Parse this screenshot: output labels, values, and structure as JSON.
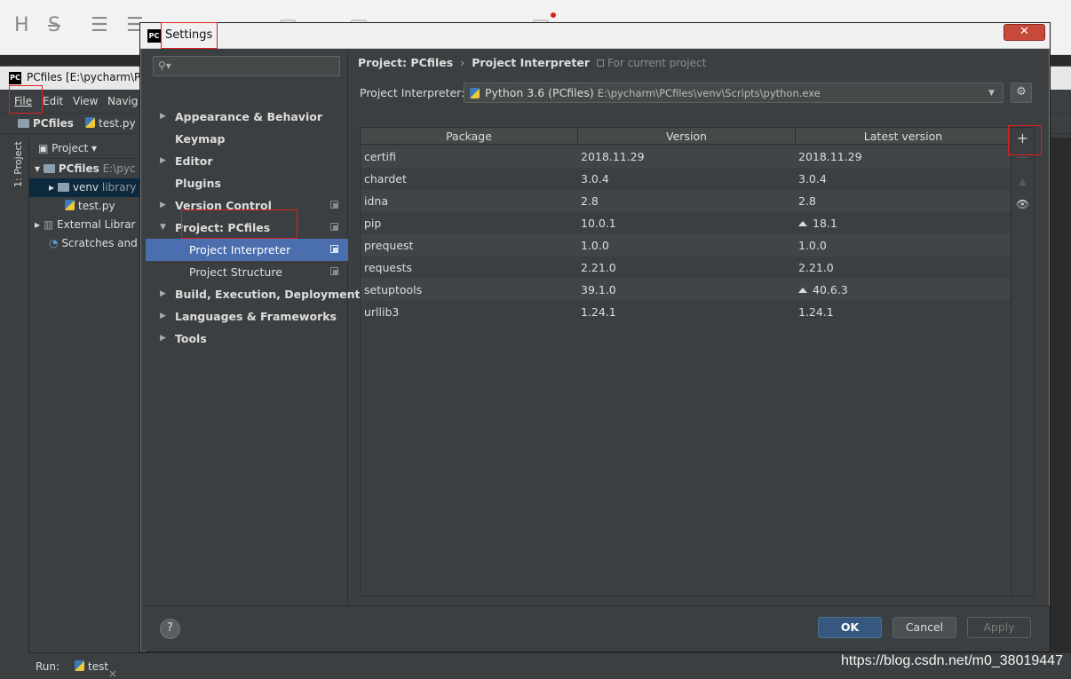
{
  "background_window": {
    "title": "PCfiles [E:\\pycharm\\PC",
    "menu": [
      "File",
      "Edit",
      "View",
      "Navig"
    ],
    "nav_project": "PCfiles",
    "nav_file": "test.py",
    "side_tab": "1: Project",
    "project_header": "Project",
    "tree": [
      {
        "label": "PCfiles",
        "extra": "E:\\pyc"
      },
      {
        "label": "venv",
        "extra": "library"
      },
      {
        "label": "test.py",
        "extra": ""
      },
      {
        "label": "External Librar",
        "extra": ""
      },
      {
        "label": "Scratches and",
        "extra": ""
      }
    ],
    "run_label": "Run:",
    "run_tab": "test"
  },
  "dialog": {
    "title": "Settings",
    "close_glyph": "✕",
    "search_placeholder": "",
    "nav_items": [
      {
        "label": "Appearance & Behavior",
        "expandable": true,
        "copy": false
      },
      {
        "label": "Keymap",
        "expandable": false,
        "copy": false
      },
      {
        "label": "Editor",
        "expandable": true,
        "copy": false
      },
      {
        "label": "Plugins",
        "expandable": false,
        "copy": false
      },
      {
        "label": "Version Control",
        "expandable": true,
        "copy": true
      },
      {
        "label": "Project: PCfiles",
        "expandable": true,
        "copy": true
      },
      {
        "label": "Project Interpreter",
        "child": true,
        "selected": true,
        "copy": true
      },
      {
        "label": "Project Structure",
        "child": true,
        "copy": true
      },
      {
        "label": "Build, Execution, Deployment",
        "expandable": true,
        "copy": false
      },
      {
        "label": "Languages & Frameworks",
        "expandable": true,
        "copy": false
      },
      {
        "label": "Tools",
        "expandable": true,
        "copy": false
      }
    ],
    "breadcrumb": {
      "parent": "Project: PCfiles",
      "sep": "›",
      "current": "Project Interpreter"
    },
    "for_current_project": "For current project",
    "interpreter": {
      "label": "Project Interpreter:",
      "value": "Python 3.6 (PCfiles)",
      "path": "E:\\pycharm\\PCfiles\\venv\\Scripts\\python.exe"
    },
    "table": {
      "columns": [
        "Package",
        "Version",
        "Latest version"
      ],
      "rows": [
        {
          "package": "certifi",
          "version": "2018.11.29",
          "latest": "2018.11.29",
          "upgrade": false
        },
        {
          "package": "chardet",
          "version": "3.0.4",
          "latest": "3.0.4",
          "upgrade": false
        },
        {
          "package": "idna",
          "version": "2.8",
          "latest": "2.8",
          "upgrade": false
        },
        {
          "package": "pip",
          "version": "10.0.1",
          "latest": "18.1",
          "upgrade": true
        },
        {
          "package": "prequest",
          "version": "1.0.0",
          "latest": "1.0.0",
          "upgrade": false
        },
        {
          "package": "requests",
          "version": "2.21.0",
          "latest": "2.21.0",
          "upgrade": false
        },
        {
          "package": "setuptools",
          "version": "39.1.0",
          "latest": "40.6.3",
          "upgrade": true
        },
        {
          "package": "urllib3",
          "version": "1.24.1",
          "latest": "1.24.1",
          "upgrade": false
        }
      ]
    },
    "side_tools": {
      "add": "+",
      "remove": "—",
      "upgrade": "▲",
      "show": "👁"
    },
    "buttons": {
      "help": "?",
      "ok": "OK",
      "cancel": "Cancel",
      "apply": "Apply"
    }
  },
  "colors": {
    "accent": "#4b6eaf",
    "annotation": "#e02020",
    "ok_button": "#365880"
  },
  "watermark": "https://blog.csdn.net/m0_38019447"
}
